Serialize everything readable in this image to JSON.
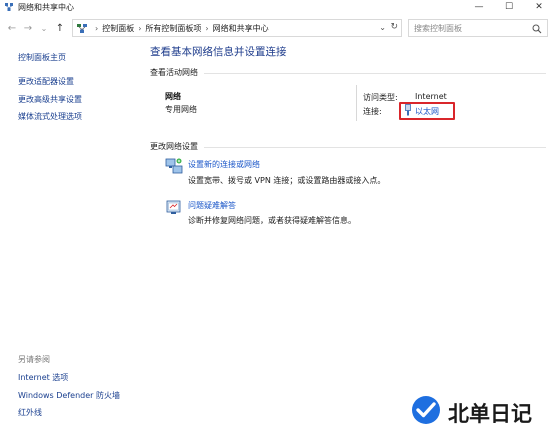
{
  "window": {
    "title": "网络和共享中心",
    "minimize": "—",
    "maximize": "☐",
    "close": "✕"
  },
  "nav": {
    "back": "←",
    "forward": "→",
    "recent": "⌄",
    "up": "↑"
  },
  "address": {
    "crumbs": [
      "控制面板",
      "所有控制面板项",
      "网络和共享中心"
    ],
    "separator": "›",
    "dropdown": "⌄",
    "refresh": "↻"
  },
  "search": {
    "placeholder": "搜索控制面板"
  },
  "sidebar": {
    "home": "控制面板主页",
    "links": [
      "更改适配器设置",
      "更改高级共享设置",
      "媒体流式处理选项"
    ],
    "see_also_heading": "另请参阅",
    "see_also": [
      "Internet 选项",
      "Windows Defender 防火墙",
      "红外线"
    ]
  },
  "main": {
    "title": "查看基本网络信息并设置连接",
    "active_networks_heading": "查看活动网络",
    "network": {
      "name": "网络",
      "category": "专用网络",
      "access_type_label": "访问类型:",
      "access_type_value": "Internet",
      "connection_label": "连接:",
      "connection_value": "以太网"
    },
    "change_settings_heading": "更改网络设置",
    "tasks": [
      {
        "link": "设置新的连接或网络",
        "description": "设置宽带、拨号或 VPN 连接；或设置路由器或接入点。",
        "icon": "network-setup-icon"
      },
      {
        "link": "问题疑难解答",
        "description": "诊断并修复网络问题，或者获得疑难解答信息。",
        "icon": "troubleshoot-icon"
      }
    ]
  },
  "watermark": {
    "text": "北单日记"
  },
  "colors": {
    "link": "#1a56c8",
    "title": "#1e3c8c",
    "highlight": "#d9262b",
    "watermark_blue": "#1e6fe0"
  }
}
